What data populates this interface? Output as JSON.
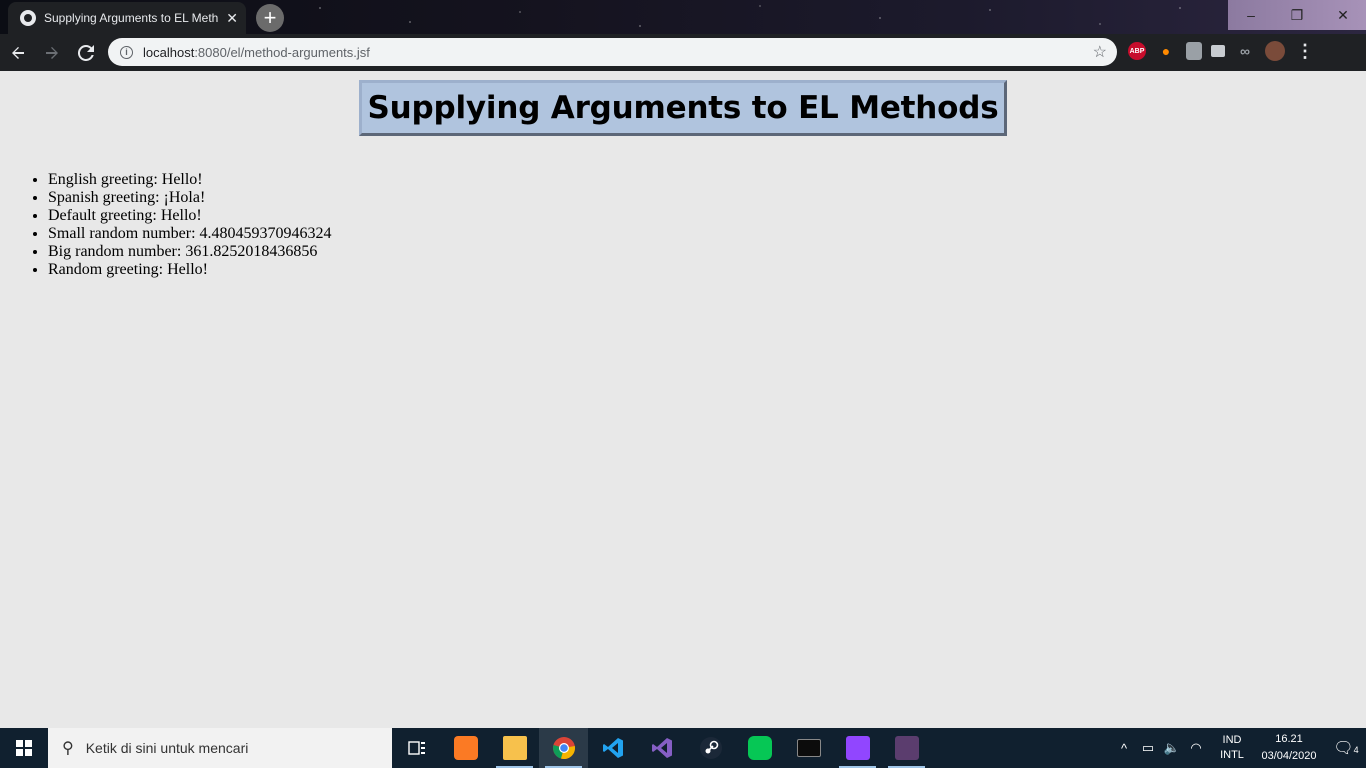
{
  "browser": {
    "tab_title": "Supplying Arguments to EL Meth",
    "tab_close": "✕",
    "new_tab": "+",
    "url_host": "localhost",
    "url_rest": ":8080/el/method-arguments.jsf",
    "window_controls": {
      "minimize": "–",
      "maximize": "❐",
      "close": "✕"
    },
    "icons": [
      "back-icon",
      "forward-icon",
      "reload-icon",
      "info-icon",
      "star-icon"
    ],
    "extensions": {
      "abp": "ABP"
    }
  },
  "page": {
    "heading": "Supplying Arguments to EL Methods",
    "heading_bg": "#b0c4de",
    "items": [
      "English greeting: Hello!",
      "Spanish greeting: ¡Hola!",
      "Default greeting: Hello!",
      "Small random number: 4.480459370946324",
      "Big random number: 361.8252018436856",
      "Random greeting: Hello!"
    ]
  },
  "taskbar": {
    "search_placeholder": "Ketik di sini untuk mencari",
    "lang_top": "IND",
    "lang_bottom": "INTL",
    "time": "16.21",
    "date": "03/04/2020",
    "notifications": "4"
  }
}
